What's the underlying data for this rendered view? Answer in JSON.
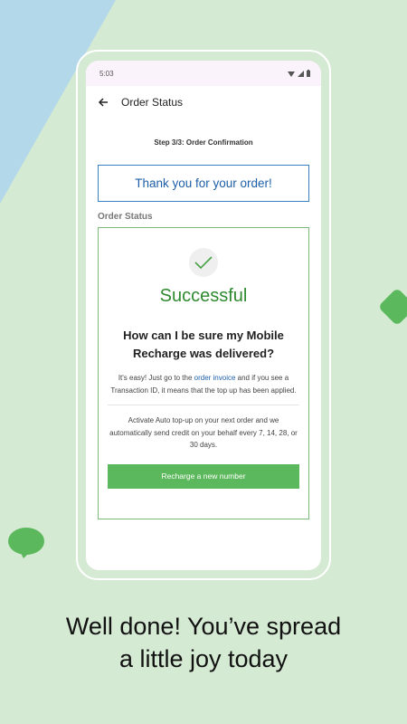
{
  "status_bar": {
    "time": "5:03",
    "icons": [
      "wifi-icon",
      "signal-icon",
      "battery-icon"
    ]
  },
  "app_bar": {
    "back_icon": "arrow-left-icon",
    "title": "Order Status"
  },
  "step_text": "Step 3/3: Order Confirmation",
  "thank_you": "Thank you for your order!",
  "section_label": "Order Status",
  "card": {
    "check_icon": "checkmark-icon",
    "success": "Successful",
    "question": "How can I be sure my Mobile Recharge was delivered?",
    "answer_prefix": "It's easy! Just go to the ",
    "answer_link": "order invoice",
    "answer_suffix": " and if you see a Transaction ID, it means that the top up has been applied.",
    "auto_topup": "Activate Auto top-up on your next order and we automatically send credit on your behalf every 7, 14, 28, or 30 days.",
    "button_label": "Recharge a new number"
  },
  "headline": {
    "line1": "Well done! You’ve spread",
    "line2": "a little joy today"
  },
  "colors": {
    "background": "#d5ead3",
    "accent_green": "#5cb85c",
    "success_green": "#2f8a2f",
    "link_blue": "#1d5fa8",
    "bg_blue": "#b3d8ea"
  }
}
